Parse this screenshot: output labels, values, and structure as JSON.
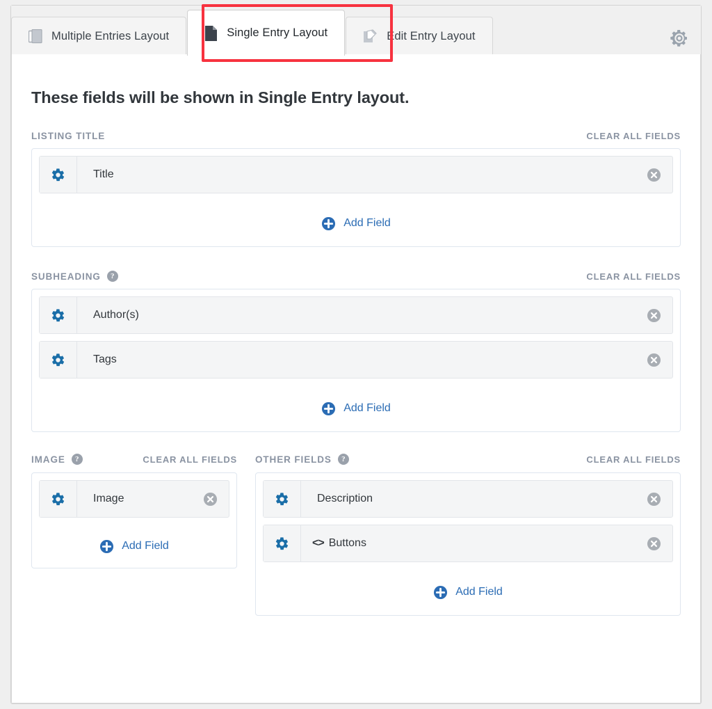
{
  "tabs": [
    {
      "label": "Multiple Entries Layout",
      "icon": "copy-pages-icon",
      "active": false
    },
    {
      "label": "Single Entry Layout",
      "icon": "document-icon",
      "active": true
    },
    {
      "label": "Edit Entry Layout",
      "icon": "edit-pencil-icon",
      "active": false
    }
  ],
  "toolbar": {
    "settings_icon": "gear-icon"
  },
  "annotation": {
    "shape": "rectangle",
    "color": "#f7323f",
    "targets_tab": "Single Entry Layout"
  },
  "main": {
    "title": "These fields will be shown in Single Entry layout.",
    "clear_all_label": "CLEAR ALL FIELDS",
    "add_field_label": "Add Field",
    "help_glyph": "?",
    "sections": [
      {
        "label": "LISTING TITLE",
        "has_help": false,
        "fields": [
          {
            "name": "Title",
            "code": ""
          }
        ]
      },
      {
        "label": "SUBHEADING",
        "has_help": true,
        "fields": [
          {
            "name": "Author(s)",
            "code": ""
          },
          {
            "name": "Tags",
            "code": ""
          }
        ]
      }
    ],
    "columns": [
      {
        "label": "IMAGE",
        "has_help": true,
        "fields": [
          {
            "name": "Image",
            "code": ""
          }
        ]
      },
      {
        "label": "OTHER FIELDS",
        "has_help": true,
        "fields": [
          {
            "name": "Description",
            "code": ""
          },
          {
            "name": "Buttons",
            "code": "<>"
          }
        ]
      }
    ]
  },
  "colors": {
    "accent_blue": "#2b6cb4",
    "gear_blue": "#1a6ea8",
    "label_gray": "#8a93a2",
    "annotation_red": "#f7323f",
    "row_bg": "#f4f5f6"
  }
}
